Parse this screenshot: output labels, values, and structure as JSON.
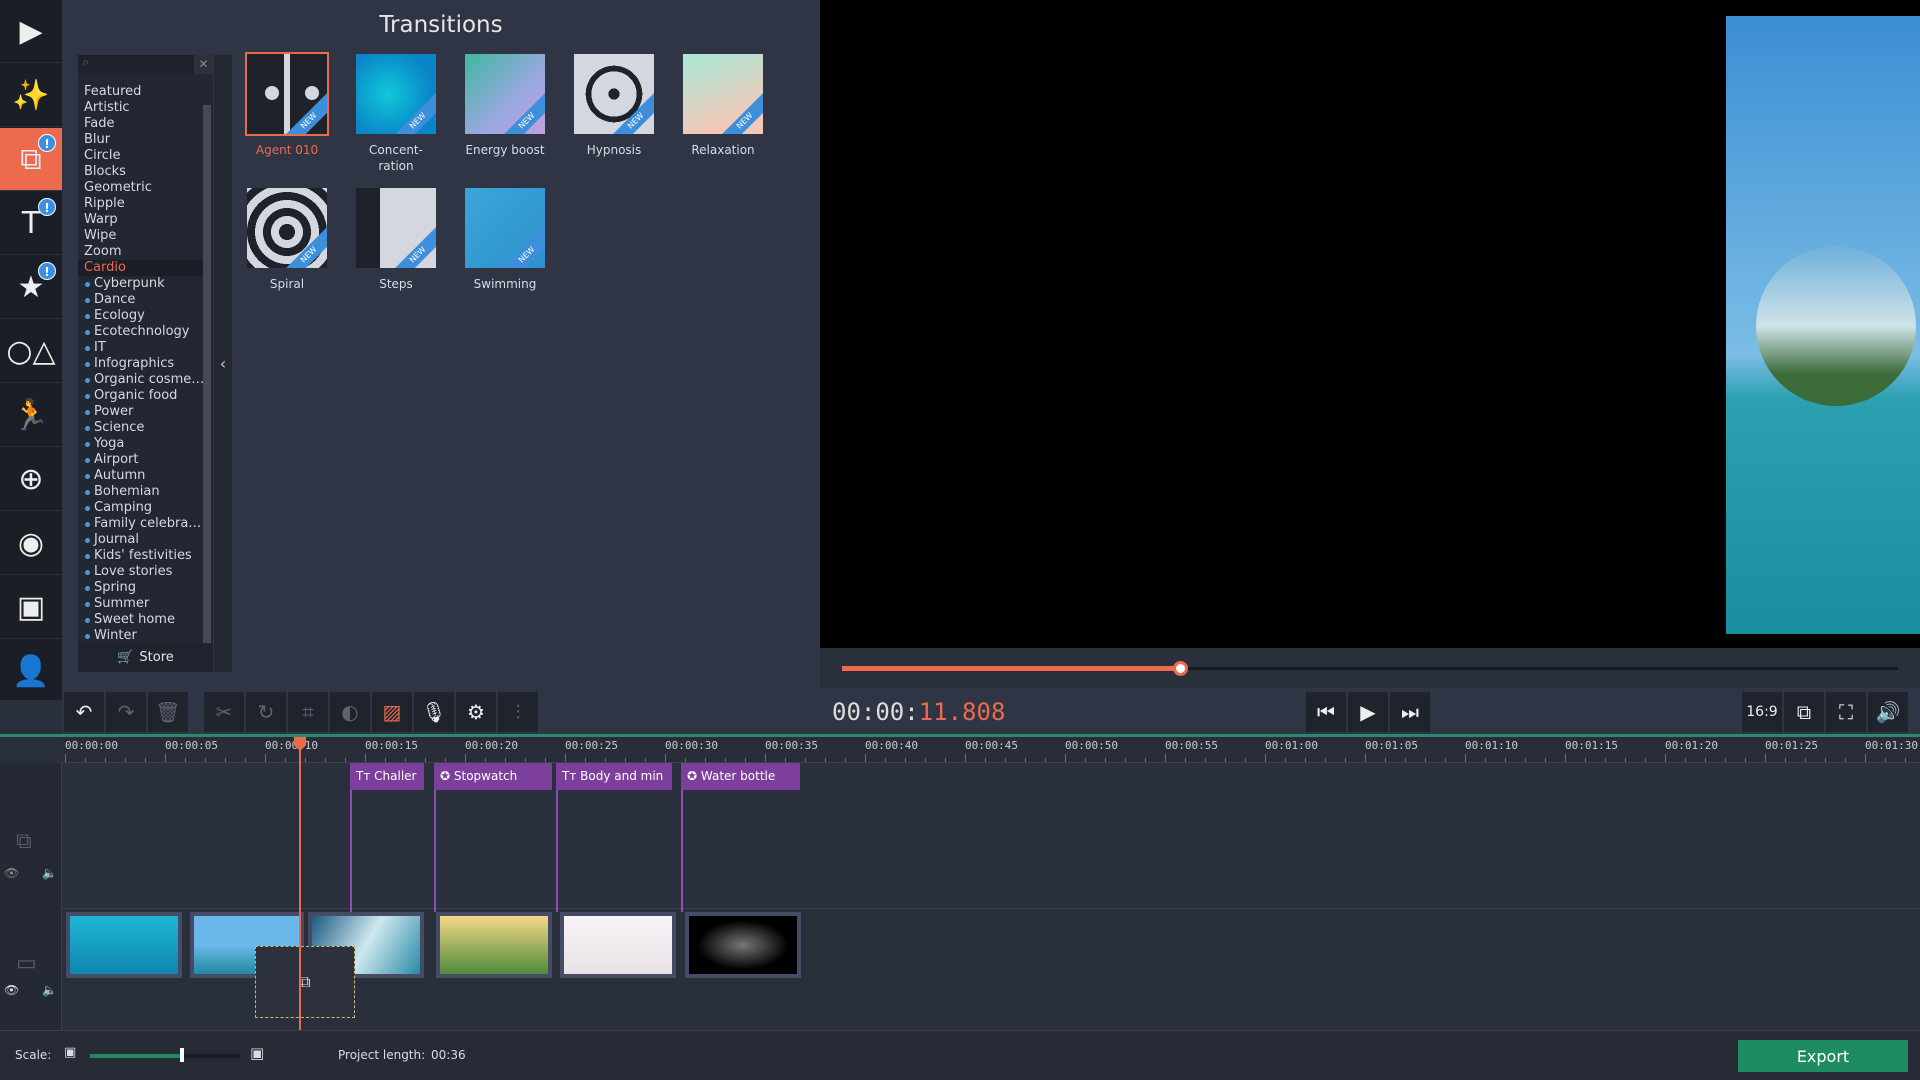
{
  "sidebar": {
    "items": [
      {
        "name": "import",
        "icon": "film-play-icon",
        "glyph": "▶"
      },
      {
        "name": "filters",
        "icon": "magic-wand-icon",
        "glyph": "✨"
      },
      {
        "name": "transitions",
        "icon": "transitions-icon",
        "glyph": "⧉",
        "active": true,
        "badge": "!"
      },
      {
        "name": "titles",
        "icon": "text-icon",
        "glyph": "T",
        "badge": "!"
      },
      {
        "name": "stickers",
        "icon": "star-sticker-icon",
        "glyph": "★",
        "badge": "!"
      },
      {
        "name": "callouts",
        "icon": "shapes-icon",
        "glyph": "○△"
      },
      {
        "name": "animation",
        "icon": "running-man-icon",
        "glyph": "🏃"
      },
      {
        "name": "zoom",
        "icon": "zoom-icon",
        "glyph": "⊕"
      },
      {
        "name": "record",
        "icon": "camera-record-icon",
        "glyph": "◉"
      },
      {
        "name": "vignette",
        "icon": "vignette-icon",
        "glyph": "▣"
      },
      {
        "name": "chroma",
        "icon": "chroma-key-icon",
        "glyph": "👤"
      }
    ]
  },
  "panel": {
    "title": "Transitions",
    "store_label": "Store",
    "categories": [
      "Featured",
      "Artistic",
      "Fade",
      "Blur",
      "Circle",
      "Blocks",
      "Geometric",
      "Ripple",
      "Warp",
      "Wipe",
      "Zoom",
      "Cardio"
    ],
    "selected_category": "Cardio",
    "subcategories": [
      "Cyberpunk",
      "Dance",
      "Ecology",
      "Ecotechnology",
      "IT",
      "Infographics",
      "Organic cosmet…",
      "Organic food",
      "Power",
      "Science",
      "Yoga",
      "Airport",
      "Autumn",
      "Bohemian",
      "Camping",
      "Family celebrati…",
      "Journal",
      "Kids' festivities",
      "Love stories",
      "Spring",
      "Summer",
      "Sweet home",
      "Winter"
    ],
    "transitions": [
      {
        "label": "Agent 010",
        "selected": true,
        "badge": "NEW"
      },
      {
        "label": "Concent-\nration",
        "badge": "NEW"
      },
      {
        "label": "Energy boost",
        "badge": "NEW"
      },
      {
        "label": "Hypnosis",
        "badge": "NEW"
      },
      {
        "label": "Relaxation",
        "badge": "NEW"
      },
      {
        "label": "Spiral",
        "badge": "NEW"
      },
      {
        "label": "Steps",
        "badge": "NEW"
      },
      {
        "label": "Swimming",
        "badge": "NEW"
      }
    ]
  },
  "player": {
    "timecode_gray": "00:00:",
    "timecode_accent": "11.808",
    "progress": 0.32,
    "aspect": "16:9"
  },
  "colors": {
    "accent": "#ec6b4e",
    "export": "#1f8b60",
    "title_clip": "#7c3f9c",
    "new_badge": "#3d8fdc"
  },
  "timeline": {
    "ticks": [
      "00:00:00",
      "00:00:05",
      "00:00:10",
      "00:00:15",
      "00:00:20",
      "00:00:25",
      "00:00:30",
      "00:00:35",
      "00:00:40",
      "00:00:45",
      "00:00:50",
      "00:00:55",
      "00:01:00",
      "00:01:05",
      "00:01:10",
      "00:01:15",
      "00:01:20",
      "00:01:25",
      "00:01:30"
    ],
    "title_clips": [
      {
        "label": "Challer",
        "icon": "text-icon"
      },
      {
        "label": "Stopwatch",
        "icon": "sticker-icon"
      },
      {
        "label": "Body and min",
        "icon": "text-icon"
      },
      {
        "label": "Water bottle",
        "icon": "sticker-icon"
      }
    ],
    "video_clips": [
      "swimmers",
      "kitesurf",
      "surfer",
      "runners",
      "yoga",
      "boxer"
    ]
  },
  "footer": {
    "scale_label": "Scale:",
    "scale_value": 0.6,
    "project_length_label": "Project length:",
    "project_length": "00:36",
    "export_label": "Export"
  }
}
